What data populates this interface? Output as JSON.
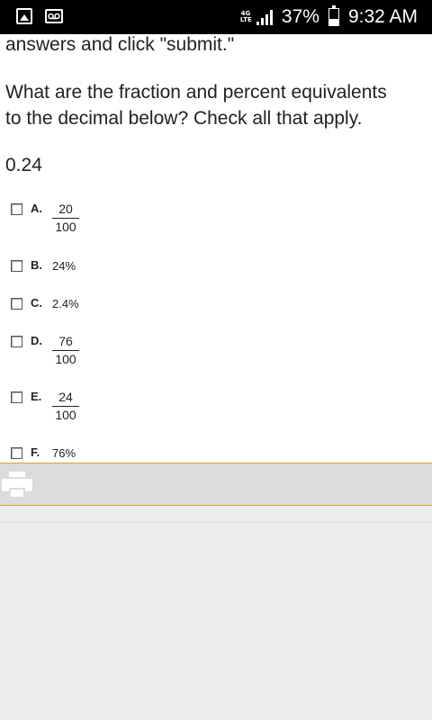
{
  "status_bar": {
    "network": "4G",
    "network_sub": "LTE",
    "battery": "37%",
    "battery_level": 0.37,
    "time": "9:32 AM"
  },
  "content": {
    "instructions_fragment": "answers and click \"submit.\"",
    "question_line1": "What are the fraction and percent equivalents",
    "question_line2": "to the decimal below? Check all that apply.",
    "decimal": "0.24"
  },
  "options": [
    {
      "letter": "A.",
      "numerator": "20",
      "denominator": "100"
    },
    {
      "letter": "B.",
      "text": "24%"
    },
    {
      "letter": "C.",
      "text": "2.4%"
    },
    {
      "letter": "D.",
      "numerator": "76",
      "denominator": "100"
    },
    {
      "letter": "E.",
      "numerator": "24",
      "denominator": "100"
    },
    {
      "letter": "F.",
      "text": "76%"
    }
  ],
  "footer": {
    "icon": "print-icon"
  }
}
